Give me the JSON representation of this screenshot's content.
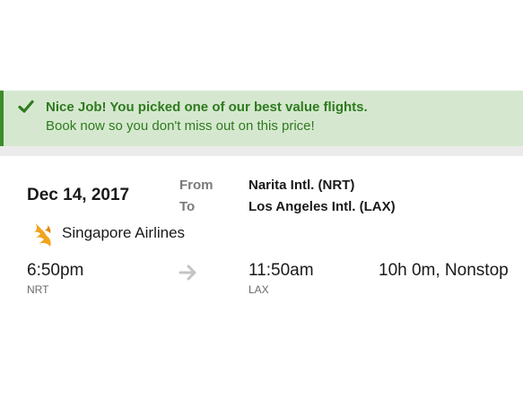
{
  "alert": {
    "icon": "checkmark-icon",
    "title": "Nice Job! You picked one of our best value flights.",
    "subtitle": "Book now so you don't miss out on this price!",
    "accent_color": "#2f7a1f",
    "background_color": "#d5e8cf"
  },
  "flight": {
    "date": "Dec 14, 2017",
    "from_label": "From",
    "to_label": "To",
    "from_airport": "Narita Intl. (NRT)",
    "to_airport": "Los Angeles Intl. (LAX)",
    "airline": {
      "name": "Singapore Airlines",
      "logo_icon": "singapore-airlines-bird-logo",
      "logo_color": "#f2a31b"
    },
    "departure": {
      "time": "6:50pm",
      "code": "NRT"
    },
    "arrow_icon": "right-arrow-icon",
    "arrival": {
      "time": "11:50am",
      "code": "LAX"
    },
    "duration": "10h 0m, Nonstop"
  }
}
